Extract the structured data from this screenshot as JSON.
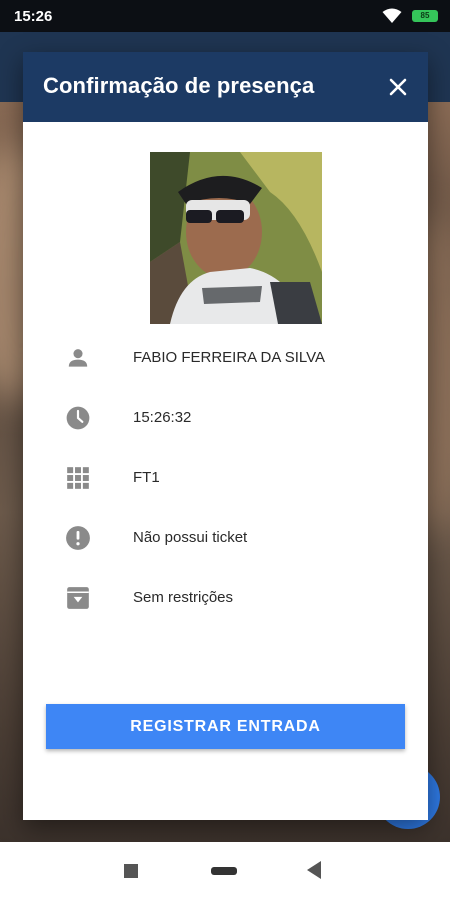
{
  "status_bar": {
    "time": "15:26",
    "battery": "85"
  },
  "dialog": {
    "title": "Confirmação de presença",
    "close_label": "×",
    "rows": [
      {
        "icon": "person-icon",
        "text": "FABIO FERREIRA DA SILVA"
      },
      {
        "icon": "clock-icon",
        "text": "15:26:32"
      },
      {
        "icon": "grid-icon",
        "text": "FT1"
      },
      {
        "icon": "alert-circle-icon",
        "text": "Não possui ticket"
      },
      {
        "icon": "archive-icon",
        "text": "Sem restrições"
      }
    ],
    "register_button": "REGISTRAR ENTRADA"
  },
  "colors": {
    "header": "#1c3a64",
    "button": "#3e86f5",
    "icon": "#8a8a8a"
  }
}
